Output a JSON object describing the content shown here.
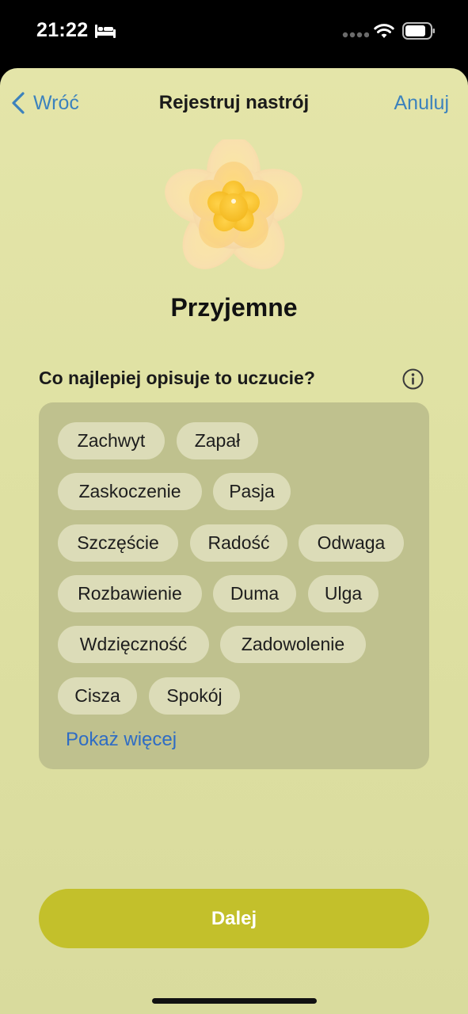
{
  "status_bar": {
    "time": "21:22",
    "icons": [
      "bed-icon",
      "signal-icon",
      "wifi-icon",
      "battery-icon"
    ]
  },
  "nav": {
    "back_label": "Wróć",
    "title": "Rejestruj nastrój",
    "cancel_label": "Anuluj"
  },
  "mood": {
    "icon": "flower-icon",
    "label": "Przyjemne"
  },
  "question": {
    "text": "Co najlepiej opisuje to uczucie?",
    "info_icon": "info-icon"
  },
  "tags": [
    "Zachwyt",
    "Zapał",
    "Zaskoczenie",
    "Pasja",
    "Szczęście",
    "Radość",
    "Odwaga",
    "Rozbawienie",
    "Duma",
    "Ulga",
    "Wdzięczność",
    "Zadowolenie",
    "Cisza",
    "Spokój"
  ],
  "show_more_label": "Pokaż więcej",
  "next_label": "Dalej",
  "colors": {
    "accent": "#3c82bd",
    "link": "#2e6cc4",
    "button": "#c3c02b",
    "background": "#e2e3a7",
    "card": "#bfc18e",
    "tag": "#dcdcb8"
  }
}
